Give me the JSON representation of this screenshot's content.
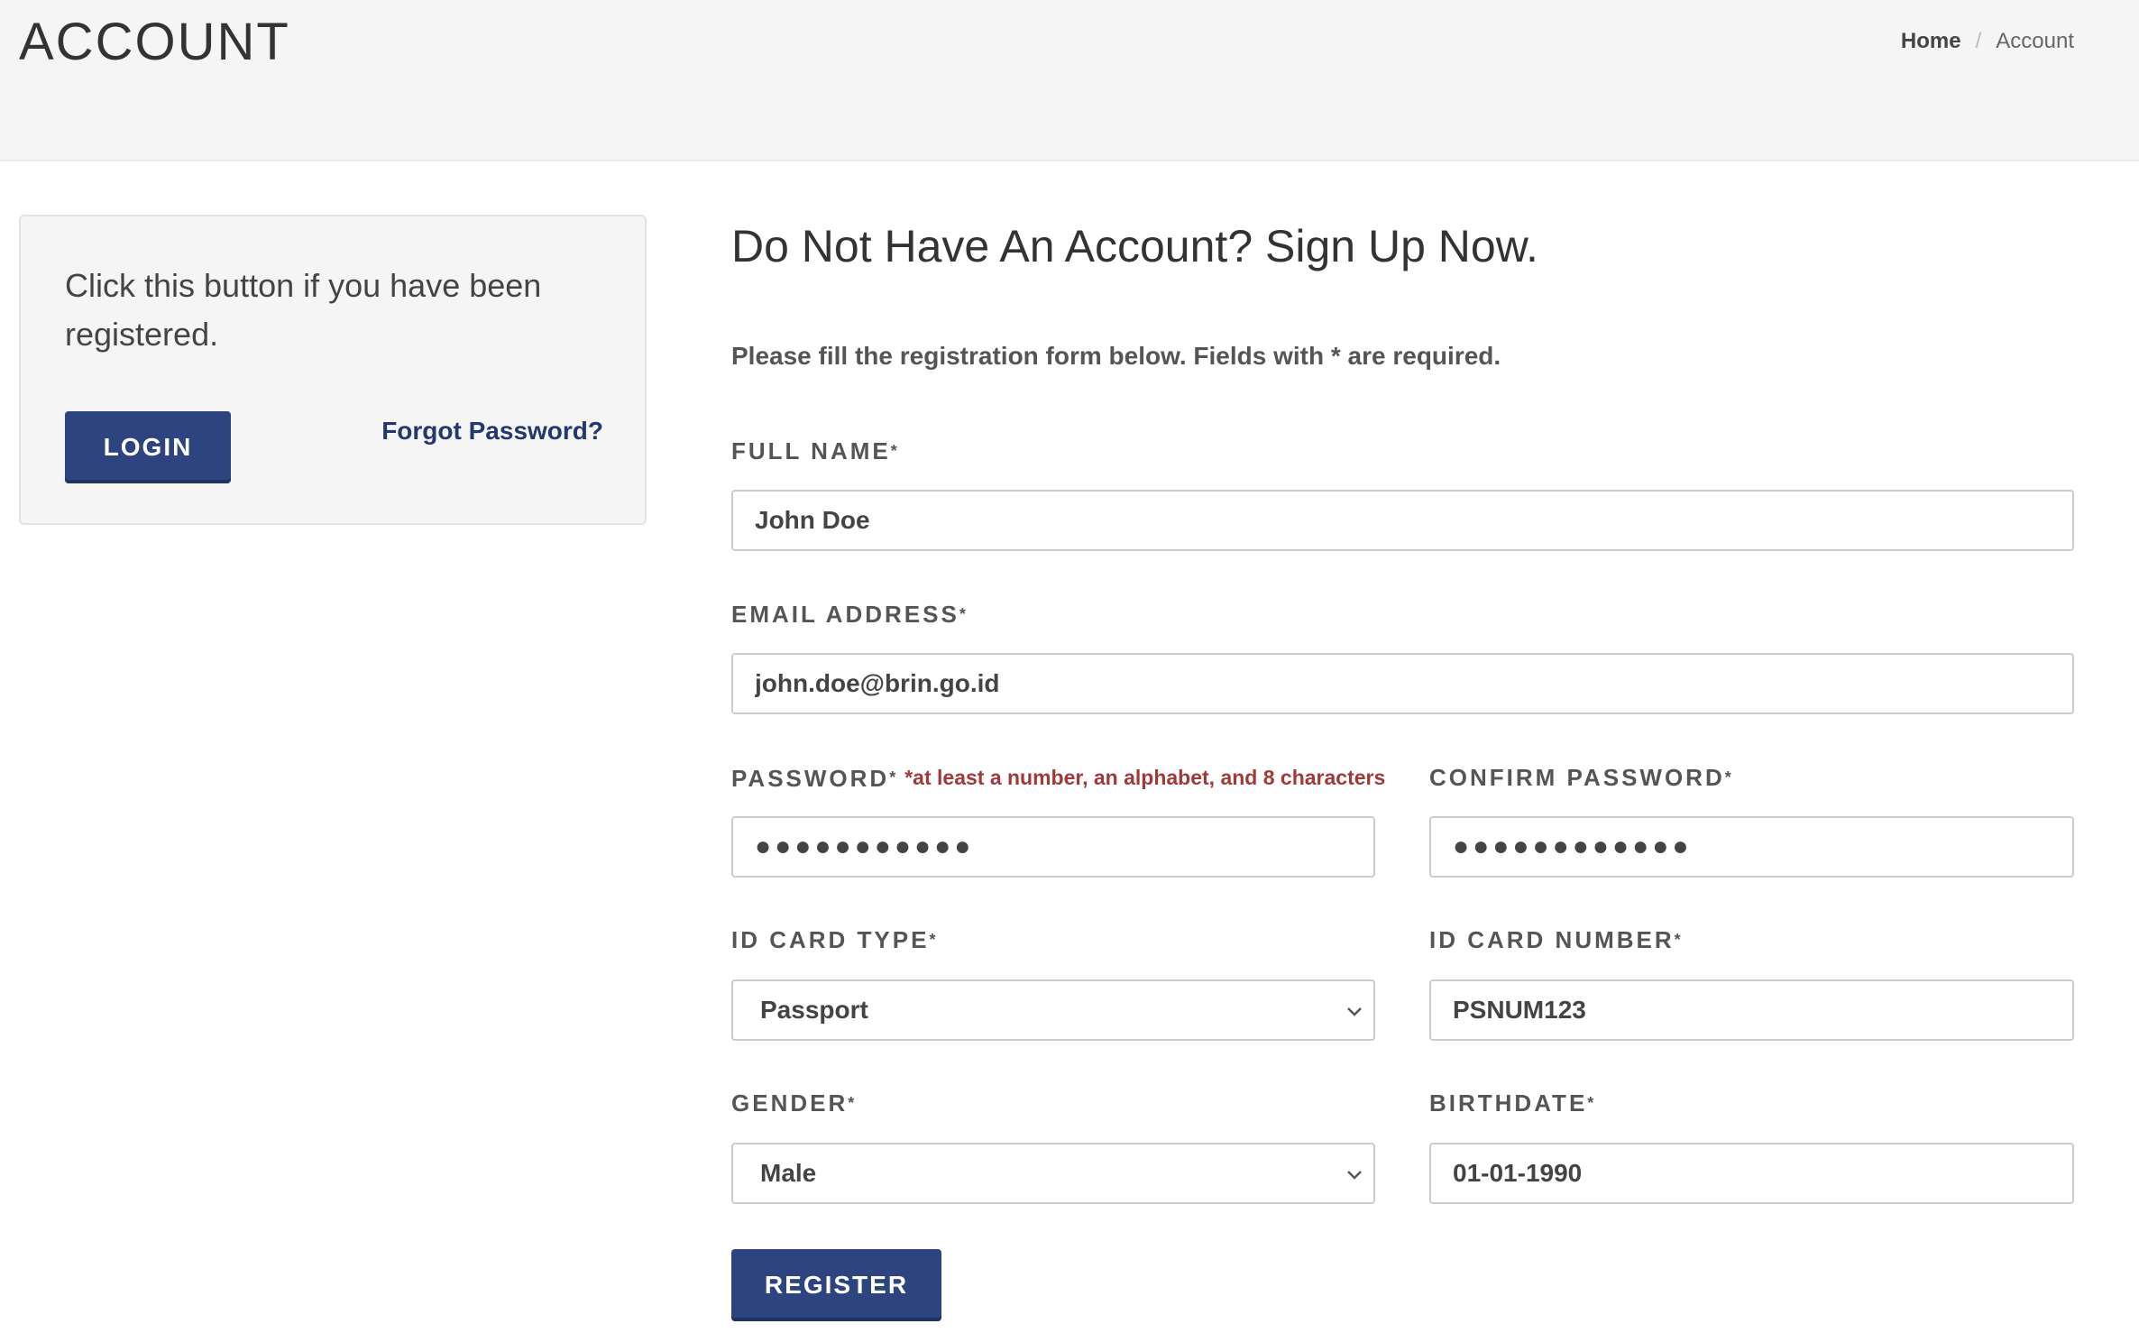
{
  "header": {
    "title": "ACCOUNT",
    "breadcrumb": {
      "home": "Home",
      "separator": "/",
      "current": "Account"
    }
  },
  "login_box": {
    "text": "Click this button if you have been registered.",
    "login_label": "LOGIN",
    "forgot_label": "Forgot Password?"
  },
  "form": {
    "title": "Do Not Have An Account? Sign Up Now.",
    "intro": "Please fill the registration form below. Fields with * are required.",
    "required_marker": "*",
    "full_name": {
      "label": "FULL NAME",
      "value": "John Doe"
    },
    "email": {
      "label": "EMAIL ADDRESS",
      "value": "john.doe@brin.go.id"
    },
    "password": {
      "label": "PASSWORD",
      "hint": "*at least a number, an alphabet, and 8 characters",
      "value": "●●●●●●●●●●●"
    },
    "confirm_password": {
      "label": "CONFIRM PASSWORD",
      "value": "●●●●●●●●●●●●"
    },
    "id_card_type": {
      "label": "ID CARD TYPE",
      "value": "Passport"
    },
    "id_card_number": {
      "label": "ID CARD NUMBER",
      "value": "PSNUM123"
    },
    "gender": {
      "label": "GENDER",
      "value": "Male"
    },
    "birthdate": {
      "label": "BIRTHDATE",
      "value": "01-01-1990"
    },
    "register_label": "REGISTER"
  },
  "colors": {
    "primary_button": "#2e4480",
    "link": "#24386e",
    "hint": "#a03a3a",
    "header_bg": "#f5f5f5"
  }
}
